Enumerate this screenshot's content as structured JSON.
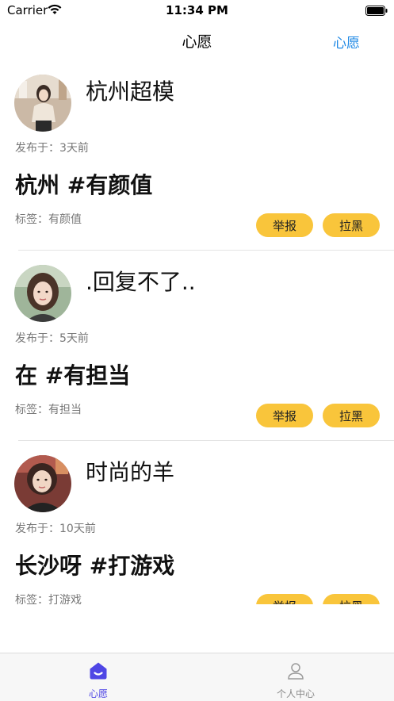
{
  "status_bar": {
    "carrier": "Carrier",
    "time": "11:34 PM"
  },
  "nav": {
    "title": "心愿",
    "right_button": "心愿"
  },
  "posts": [
    {
      "username": "杭州超模",
      "posted_label": "发布于：",
      "posted_time": "3天前",
      "title": "杭州 #有颜值",
      "tag_label": "标签：",
      "tag": "有颜值",
      "report_label": "举报",
      "block_label": "拉黑"
    },
    {
      "username": ".回复不了..",
      "posted_label": "发布于：",
      "posted_time": "5天前",
      "title": "在 #有担当",
      "tag_label": "标签：",
      "tag": "有担当",
      "report_label": "举报",
      "block_label": "拉黑"
    },
    {
      "username": "时尚的羊",
      "posted_label": "发布于：",
      "posted_time": "10天前",
      "title": "长沙呀 #打游戏",
      "tag_label": "标签：",
      "tag": "打游戏",
      "report_label": "举报",
      "block_label": "拉黑"
    }
  ],
  "tab_bar": {
    "items": [
      {
        "label": "心愿",
        "icon": "home-icon",
        "active": true
      },
      {
        "label": "个人中心",
        "icon": "user-icon",
        "active": false
      }
    ]
  },
  "colors": {
    "accent": "#F9C53B",
    "link": "#1E88E5",
    "tab_active": "#4F46E5",
    "tab_inactive": "#8a8a8a"
  }
}
